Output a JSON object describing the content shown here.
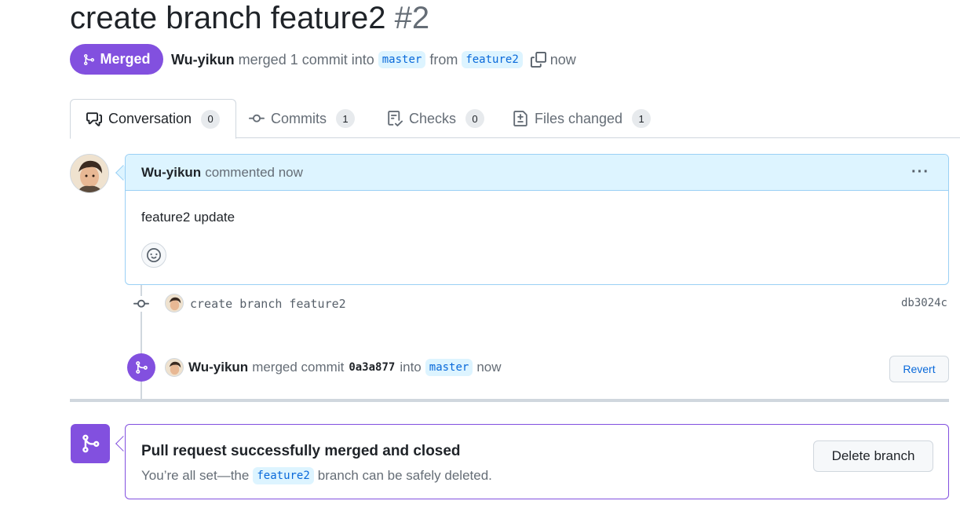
{
  "pr": {
    "title": "create branch feature2",
    "number": "#2",
    "state_label": "Merged",
    "author": "Wu-yikun",
    "summary_action": "merged 1 commit into",
    "base_branch": "master",
    "from_word": "from",
    "head_branch": "feature2",
    "time": "now"
  },
  "tabs": [
    {
      "label": "Conversation",
      "count": "0",
      "icon": "comment-discussion-icon"
    },
    {
      "label": "Commits",
      "count": "1",
      "icon": "git-commit-icon"
    },
    {
      "label": "Checks",
      "count": "0",
      "icon": "checklist-icon"
    },
    {
      "label": "Files changed",
      "count": "1",
      "icon": "file-diff-icon"
    }
  ],
  "comment": {
    "author": "Wu-yikun",
    "meta": "commented now",
    "menu": "···",
    "body": "feature2 update"
  },
  "commit": {
    "message": "create branch feature2",
    "sha": "db3024c"
  },
  "merge_event": {
    "author": "Wu-yikun",
    "action": "merged commit",
    "sha": "0a3a877",
    "into_word": "into",
    "branch": "master",
    "time": "now",
    "revert_label": "Revert"
  },
  "merged_box": {
    "title": "Pull request successfully merged and closed",
    "sub_before": "You’re all set—the",
    "branch": "feature2",
    "sub_after": "branch can be safely deleted.",
    "delete_label": "Delete branch"
  },
  "colors": {
    "accent_purple": "#8250df",
    "link_blue": "#0969da",
    "comment_header_bg": "#ddf4ff",
    "border": "#d0d7de"
  }
}
